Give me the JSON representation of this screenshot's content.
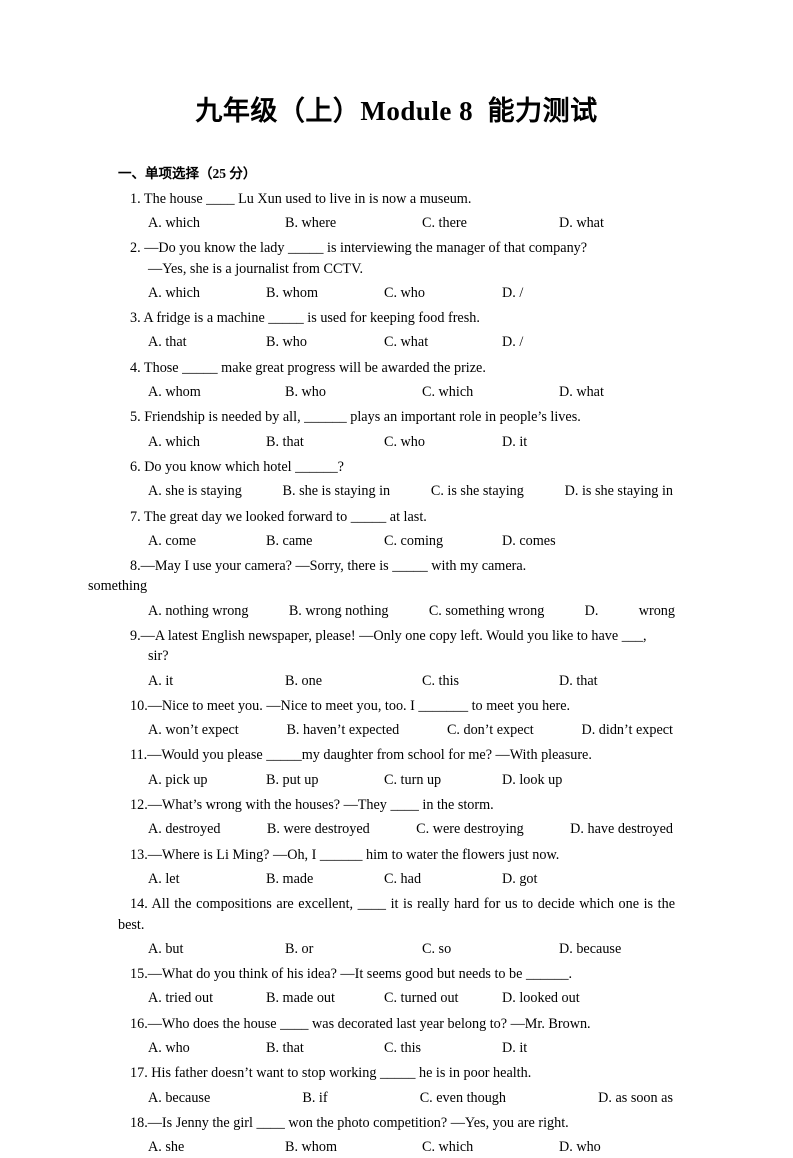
{
  "document": {
    "title": "九年级（上）Module 8  能力测试",
    "section_header": "一、单项选择（25 分）"
  },
  "questions": [
    {
      "stem": "1. The house ____ Lu Xun used to live in is now a museum.",
      "continuation": null,
      "options": [
        "A. which",
        "B. where",
        "C. there",
        "D. what"
      ],
      "layout": "cols-wide"
    },
    {
      "stem": "2.  —Do you know the lady _____ is interviewing the manager of that company?",
      "continuation": "—Yes, she is a journalist from CCTV.",
      "options": [
        "A. which",
        "B. whom",
        "C. who",
        "D. /"
      ],
      "layout": "cols-narrow"
    },
    {
      "stem": "3. A fridge is a machine _____ is used for keeping food fresh.",
      "continuation": null,
      "options": [
        "A. that",
        "B. who",
        "C. what",
        "D. /"
      ],
      "layout": "cols-narrow"
    },
    {
      "stem": "4. Those _____ make great progress will be awarded the prize.",
      "continuation": null,
      "options": [
        "A. whom",
        "B. who",
        "C. which",
        "D. what"
      ],
      "layout": "cols-wide"
    },
    {
      "stem": "5. Friendship is needed by all, ______ plays an important role in people’s lives.",
      "continuation": null,
      "options": [
        "A. which",
        "B. that",
        "C. who",
        "D. it"
      ],
      "layout": "cols-narrow"
    },
    {
      "stem": "6. Do you know which hotel ______?",
      "continuation": null,
      "options": [
        "A. she is staying",
        "B. she is staying in",
        "C. is she staying",
        "D. is she staying in"
      ],
      "layout": "cols-spread"
    },
    {
      "stem": "7. The great day we looked forward to _____ at last.",
      "continuation": null,
      "options": [
        "A. come",
        "B. came",
        "C. coming",
        "D. comes"
      ],
      "layout": "cols-narrow"
    },
    {
      "stem": "8.—May I use your camera?        —Sorry, there is _____ with my camera.",
      "continuation": "something",
      "continuation_flush": true,
      "options": [
        "A. nothing wrong",
        "B. wrong nothing",
        "C. something wrong",
        "D.",
        "wrong"
      ],
      "layout": "q8"
    },
    {
      "stem": "9.—A latest English newspaper, please!     —Only one copy left. Would you like to have ___,",
      "continuation": "sir?",
      "options": [
        "A. it",
        "B. one",
        "C. this",
        "D. that"
      ],
      "layout": "cols-wide"
    },
    {
      "stem": "10.—Nice to meet you.          —Nice to meet you, too. I _______ to meet you here.",
      "continuation": null,
      "options": [
        "A. won’t expect",
        "B. haven’t expected",
        "C. don’t expect",
        "D. didn’t expect"
      ],
      "layout": "cols-spread"
    },
    {
      "stem": "11.—Would you please _____my daughter from school for me?          —With pleasure.",
      "continuation": null,
      "options": [
        "A. pick up",
        "B. put up",
        "C. turn up",
        "D. look up"
      ],
      "layout": "cols-narrow"
    },
    {
      "stem": "12.—What’s wrong with the houses?      —They ____ in the storm.",
      "continuation": null,
      "options": [
        "A. destroyed",
        "B. were destroyed",
        "C. were destroying",
        "D. have destroyed"
      ],
      "layout": "cols-spread"
    },
    {
      "stem": "13.—Where is Li Ming?        —Oh, I ______ him to water the flowers just now.",
      "continuation": null,
      "options": [
        "A. let",
        "B. made",
        "C. had",
        "D. got"
      ],
      "layout": "cols-narrow"
    },
    {
      "stem": "14. All the compositions are excellent, ____ it is really hard for us to decide which one is the best.",
      "continuation": null,
      "options": [
        "A. but",
        "B. or",
        "C. so",
        "D. because"
      ],
      "layout": "cols-wide"
    },
    {
      "stem": "15.—What do you think of his idea?  —It seems good but needs to be ______.",
      "continuation": null,
      "options": [
        "A. tried out",
        "B. made out",
        "C. turned out",
        "D. looked out"
      ],
      "layout": "cols-narrow"
    },
    {
      "stem": "16.—Who does the house ____ was decorated last year belong to?     —Mr. Brown.",
      "continuation": null,
      "options": [
        "A. who",
        "B. that",
        "C. this",
        "D. it"
      ],
      "layout": "cols-narrow"
    },
    {
      "stem": "17. His father doesn’t want to stop working _____ he is in poor health.",
      "continuation": null,
      "options": [
        "A. because",
        "B. if",
        "C. even though",
        "D. as soon as"
      ],
      "layout": "cols-spread"
    },
    {
      "stem": "18.—Is Jenny the girl ____ won the photo competition?       —Yes, you are right.",
      "continuation": null,
      "options": [
        "A. she",
        "B. whom",
        "C. which",
        "D. who"
      ],
      "layout": "cols-wide"
    }
  ]
}
